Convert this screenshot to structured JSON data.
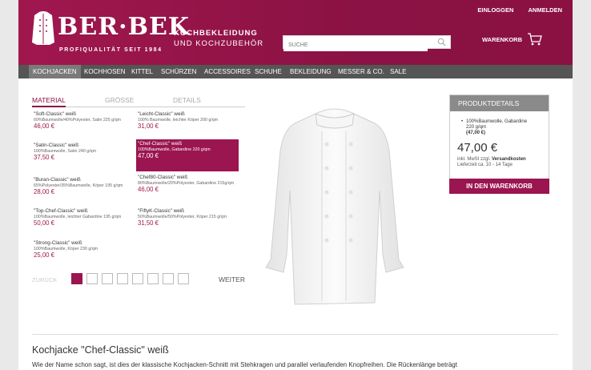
{
  "header": {
    "logo": "BER·BEK",
    "logo_sub": "PROFIQUALITÄT SEIT 1984",
    "tagline_1": "KOCHBEKLEIDUNG",
    "tagline_2": "UND KOCHZUBEHÖR",
    "login": "EINLOGGEN",
    "register": "ANMELDEN",
    "search_placeholder": "SUCHE",
    "cart": "WARENKORB"
  },
  "nav": [
    "KOCHJACKEN",
    "KOCHHOSEN",
    "KITTEL",
    "SCHÜRZEN",
    "ACCESSOIRES",
    "SCHUHE",
    "BEKLEIDUNG",
    "MESSER & CO.",
    "SALE"
  ],
  "tabs": [
    "MATERIAL",
    "GRÖSSE",
    "DETAILS"
  ],
  "products": [
    {
      "name": "\"Soft-Classic\" weiß",
      "desc": "60%Baumwolle/40%Polyester, Satin 225 g/qm",
      "price": "46,00 €"
    },
    {
      "name": "\"Leicht-Classic\" weiß",
      "desc": "100% Baumwolle, leichter Köper 200 g/qm",
      "price": "31,00 €"
    },
    {
      "name": "\"Satin-Classic\" weiß",
      "desc": "100%Baumwolle, Satin 240 g/qm",
      "price": "37,50 €"
    },
    {
      "name": "\"Chef-Classic\" weiß",
      "desc": "100%Baumwolle, Gabardine 220 g/qm",
      "price": "47,00 €"
    },
    {
      "name": "\"Buran-Classic\" weiß",
      "desc": "65%Polyester/35%Baumwolle, Köper 195 g/qm",
      "price": "28,00 €"
    },
    {
      "name": "\"Chef80-Classic\" weiß",
      "desc": "80%Baumwolle/20%Polyester, Gabardine 215g/qm",
      "price": "46,00 €"
    },
    {
      "name": "\"Top-Chef-Classic\" weiß",
      "desc": "100%Baumwolle, leichter Gabardine 195 g/qm",
      "price": "50,00 €"
    },
    {
      "name": "\"FiftyK-Classic\" weiß",
      "desc": "50%Baumwolle/50%Polyester, Köper 215 g/qm",
      "price": "31,50 €"
    },
    {
      "name": "\"Strong-Classic\" weiß",
      "desc": "100%Baumwolle, Köper 230 g/qm",
      "price": "25,00 €"
    }
  ],
  "pager": {
    "back": "ZURÜCK",
    "next": "WEITER"
  },
  "details": {
    "head": "PRODUKTDETAILS",
    "item_1": "100%Baumwolle, Gabardine",
    "item_2": "220 g/qm",
    "item_3": "(47,00 €)",
    "price": "47,00 €",
    "tax_1": "inkl. MwSt zzgl.",
    "tax_link": "Versandkosten",
    "tax_2": "Lieferzeit ca. 10 - 14 Tage",
    "buy": "IN DEN WARENKORB"
  },
  "bottom": {
    "title": "Kochjacke \"Chef-Classic\" weiß",
    "desc": "Wie der Name schon sagt, ist dies der klassische Kochjacken-Schnitt mit Stehkragen und parallel verlaufenden Knopfreihen. Die Rückenlänge beträgt"
  },
  "colors": {
    "brand": "#8b1244",
    "nav": "#555555",
    "selected": "#9b1550"
  }
}
